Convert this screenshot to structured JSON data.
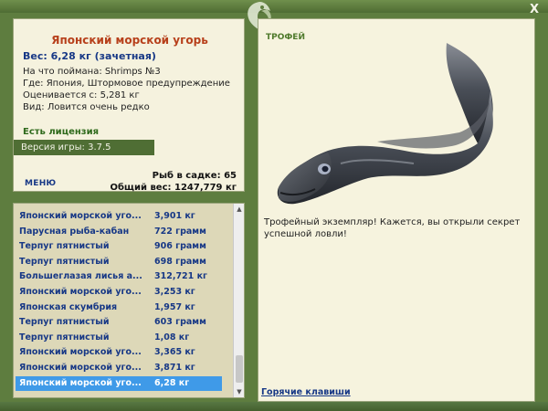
{
  "window": {
    "close_label": "X"
  },
  "fish_info": {
    "name": "Японский морской угорь",
    "weight": "Вес: 6,28 кг (зачетная)",
    "bait": "На что поймана: Shrimps №3",
    "location": "Где: Япония, Штормовое предупреждение",
    "valued_from": "Оценивается с: 5,281 кг",
    "rarity": "Вид: Ловится очень редко"
  },
  "license": "Есть лицензия",
  "version": "Версия игры: 3.7.5",
  "menu_label": "МЕНЮ",
  "stats": {
    "fish_in_keepnet": "Рыб в садке: 65",
    "total_weight": "Общий вес: 1247,779 кг"
  },
  "fish_list": [
    {
      "name": "Японский морской угорь",
      "weight": "3,901 кг"
    },
    {
      "name": "Парусная рыба-кабан",
      "weight": "722 грамм"
    },
    {
      "name": "Терпуг пятнистый",
      "weight": "906 грамм"
    },
    {
      "name": "Терпуг пятнистый",
      "weight": "698 грамм"
    },
    {
      "name": "Большеглазая лисья а...",
      "weight": "312,721 кг"
    },
    {
      "name": "Японский морской угорь",
      "weight": "3,253 кг"
    },
    {
      "name": "Японская скумбрия",
      "weight": "1,957 кг"
    },
    {
      "name": "Терпуг пятнистый",
      "weight": "603 грамм"
    },
    {
      "name": "Терпуг пятнистый",
      "weight": "1,08 кг"
    },
    {
      "name": "Японский морской угорь",
      "weight": "3,365 кг"
    },
    {
      "name": "Японский морской угорь",
      "weight": "3,871 кг"
    },
    {
      "name": "Японский морской угорь",
      "weight": "6,28 кг"
    }
  ],
  "list_display_names": [
    "Японский морской уго...",
    "Парусная рыба-кабан",
    "Терпуг пятнистый",
    "Терпуг пятнистый",
    "Большеглазая лисья а...",
    "Японский морской уго...",
    "Японская скумбрия",
    "Терпуг пятнистый",
    "Терпуг пятнистый",
    "Японский морской уго...",
    "Японский морской уго...",
    "Японский морской уго..."
  ],
  "selected_index": 11,
  "trophy": {
    "label": "ТРОФЕЙ",
    "text": "Трофейный экземпляр! Кажется, вы открыли секрет успешной ловли!"
  },
  "hotkeys_label": "Горячие клавиши",
  "colors": {
    "frame": "#5e7d3f",
    "panel": "#f5f2de",
    "list_bg": "#ddd8b8",
    "fish_name": "#b7401b",
    "link_blue": "#173886",
    "selection": "#3f9ae8"
  }
}
